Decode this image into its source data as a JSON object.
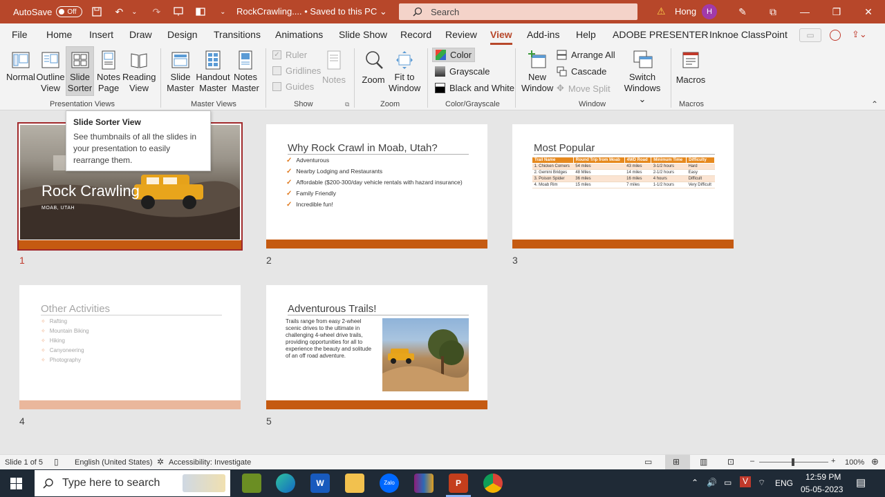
{
  "titlebar": {
    "autosave": "AutoSave",
    "toggle": "Off",
    "doc_title": "RockCrawling....  •  Saved to this PC  ⌄",
    "search_placeholder": "Search",
    "user": "Hong",
    "avatar_initial": "H"
  },
  "tabs": [
    "File",
    "Home",
    "Insert",
    "Draw",
    "Design",
    "Transitions",
    "Animations",
    "Slide Show",
    "Record",
    "Review",
    "View",
    "Add-ins",
    "Help",
    "ADOBE PRESENTER",
    "Inknoe ClassPoint"
  ],
  "ribbon": {
    "presentation_views": {
      "label": "Presentation Views",
      "normal": "Normal",
      "outline_1": "Outline",
      "outline_2": "View",
      "sorter_1": "Slide",
      "sorter_2": "Sorter",
      "notes_1": "Notes",
      "notes_2": "Page",
      "reading_1": "Reading",
      "reading_2": "View"
    },
    "master_views": {
      "label": "Master Views",
      "slide_1": "Slide",
      "slide_2": "Master",
      "handout_1": "Handout",
      "handout_2": "Master",
      "notes_1": "Notes",
      "notes_2": "Master"
    },
    "show": {
      "label": "Show",
      "ruler": "Ruler",
      "gridlines": "Gridlines",
      "guides": "Guides",
      "notes": "Notes"
    },
    "zoom": {
      "label": "Zoom",
      "zoom": "Zoom",
      "fit_1": "Fit to",
      "fit_2": "Window"
    },
    "color": {
      "label": "Color/Grayscale",
      "color": "Color",
      "grayscale": "Grayscale",
      "bw": "Black and White"
    },
    "window": {
      "label": "Window",
      "new_1": "New",
      "new_2": "Window",
      "arrange": "Arrange All",
      "cascade": "Cascade",
      "move_split": "Move Split",
      "switch_1": "Switch",
      "switch_2": "Windows ⌄"
    },
    "macros": {
      "label": "Macros",
      "macros": "Macros"
    }
  },
  "tooltip": {
    "title": "Slide Sorter View",
    "body": "See thumbnails of all the slides in your presentation to easily rearrange them."
  },
  "slides": {
    "s1": {
      "num": "1",
      "title": "Rock Crawling",
      "subtitle": "MOAB, UTAH"
    },
    "s2": {
      "num": "2",
      "title": "Why Rock Crawl in Moab, Utah?",
      "bullets": [
        "Adventurous",
        "Nearby Lodging and Restaurants",
        "Affordable ($200-300/day vehicle rentals with hazard insurance)",
        "Family Friendly",
        "Incredible fun!"
      ]
    },
    "s3": {
      "num": "3",
      "title": "Most Popular",
      "headers": [
        "Trail Name",
        "Round Trip from Moab",
        "4WD Road",
        "Minimum Time",
        "Difficulty"
      ],
      "rows": [
        [
          "1. Chicken Corners",
          "54 miles",
          "43 miles",
          "3-1/2 hours",
          "Hard"
        ],
        [
          "2. Gemini Bridges",
          "48 Miles",
          "14 miles",
          "2-1/2 hours",
          "Easy"
        ],
        [
          "3. Poison Spider",
          "36 miles",
          "16 miles",
          "4 hours",
          "Difficult"
        ],
        [
          "4. Moab Rim",
          "15 miles",
          "7 miles",
          "1-1/2 hours",
          "Very Difficult"
        ]
      ]
    },
    "s4": {
      "num": "4",
      "title": "Other Activities",
      "bullets": [
        "Rafting",
        "Mountain Biking",
        "Hiking",
        "Canyoneering",
        "Photography"
      ]
    },
    "s5": {
      "num": "5",
      "title": "Adventurous Trails!",
      "body": "Trails range from easy 2-wheel scenic drives to the ultimate in challenging 4-wheel drive trails, providing opportunities for all to experience the beauty and solitude of an off road adventure."
    }
  },
  "statusbar": {
    "slide": "Slide 1 of 5",
    "language": "English (United States)",
    "accessibility": "Accessibility: Investigate",
    "zoom": "100%"
  },
  "taskbar": {
    "search": "Type here to search",
    "lang": "ENG",
    "time": "12:59 PM",
    "date": "05-05-2023"
  },
  "colors": {
    "accent": "#b7472a",
    "slide_bar": "#c55a11",
    "table_header": "#e6891e"
  }
}
